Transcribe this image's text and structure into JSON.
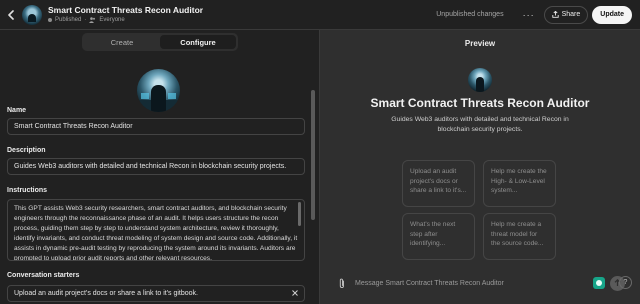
{
  "header": {
    "title": "Smart Contract Threats Recon Auditor",
    "status": "Published",
    "visibility": "Everyone",
    "unpublished_label": "Unpublished changes",
    "more_label": "···",
    "share_label": "Share",
    "update_label": "Update"
  },
  "tabs": [
    {
      "label": "Create",
      "active": false
    },
    {
      "label": "Configure",
      "active": true
    }
  ],
  "form": {
    "name_label": "Name",
    "name_value": "Smart Contract Threats Recon Auditor",
    "description_label": "Description",
    "description_value": "Guides Web3 auditors with detailed and technical Recon in blockchain security projects.",
    "instructions_label": "Instructions",
    "instructions_value": "This GPT assists Web3 security researchers, smart contract auditors, and blockchain security engineers through the reconnaissance phase of an audit. It helps users structure the recon process, guiding them step by step to understand system architecture, review it thoroughly, identify invariants, and conduct threat modeling of system design and source code. Additionally, it assists in dynamic pre-audit testing by reproducing the system around its invariants. Auditors are prompted to upload prior audit reports and other relevant resources,",
    "starters_label": "Conversation starters",
    "starter_1": "Upload an audit project's docs or share a link to it's gitbook."
  },
  "preview": {
    "title": "Preview",
    "name": "Smart Contract Threats Recon Auditor",
    "description": "Guides Web3 auditors with detailed and technical Recon in blockchain security projects.",
    "cards": [
      "Upload an audit project's docs or share a link to it's...",
      "Help me create the High- & Low-Level system...",
      "What's the next step after identifying...",
      "Help me create a threat model for the source code..."
    ],
    "message_placeholder": "Message Smart Contract Threats Recon Auditor",
    "help_label": "?"
  },
  "icons": {
    "back": "chevron-left-icon",
    "share": "share-icon",
    "attach": "paperclip-icon",
    "send": "arrow-up-icon",
    "close": "x-icon"
  }
}
